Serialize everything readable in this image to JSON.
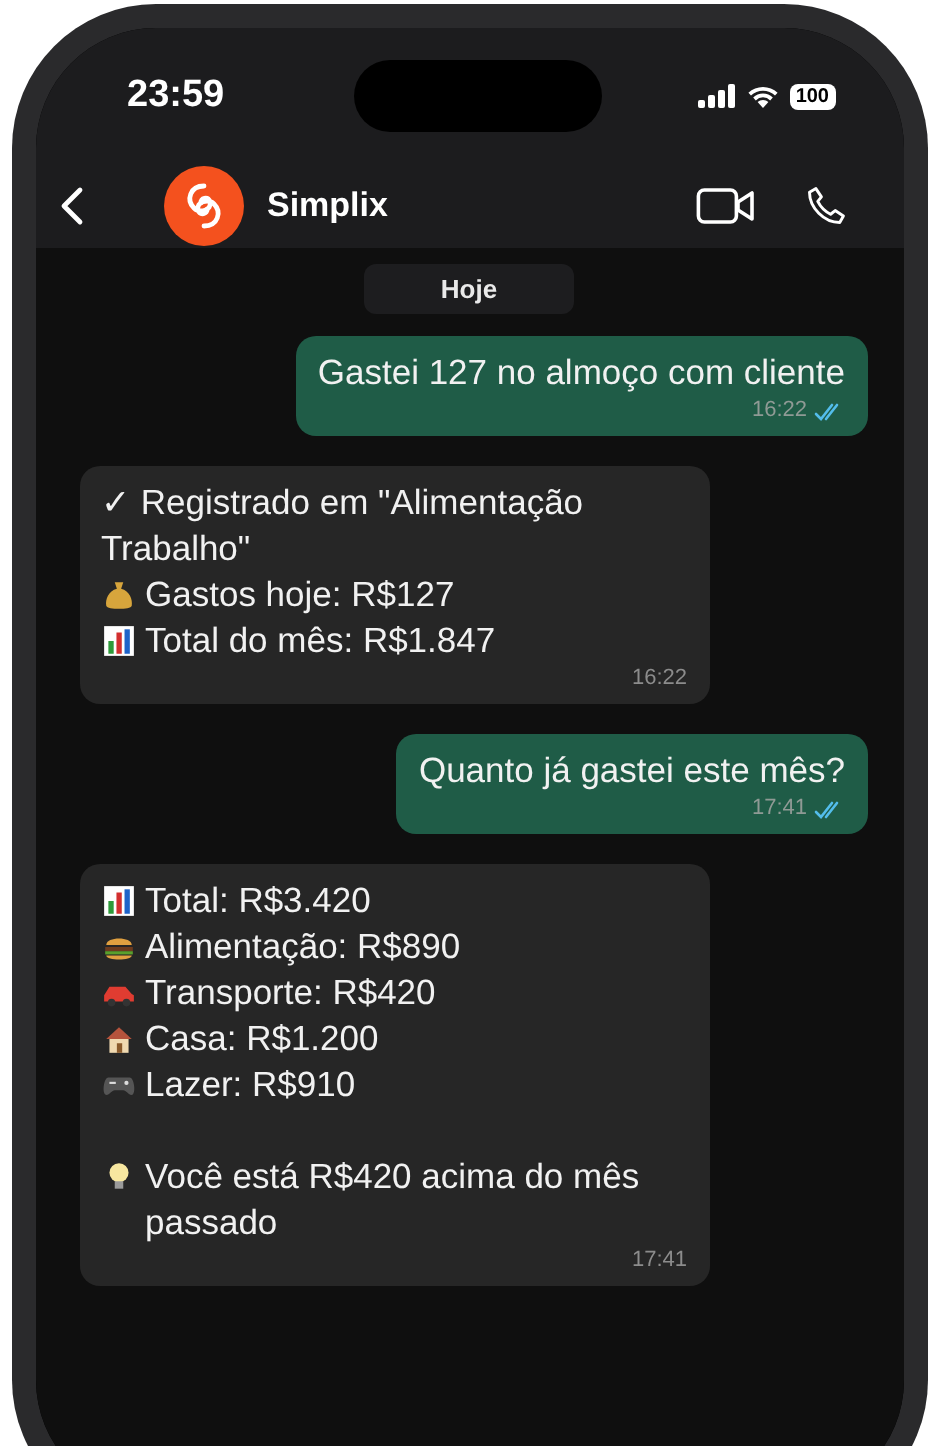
{
  "status_bar": {
    "time": "23:59",
    "battery": "100"
  },
  "header": {
    "contact": "Simplix"
  },
  "date_chip": "Hoje",
  "messages": [
    {
      "kind": "sent",
      "read": true,
      "time": "16:22",
      "lines": [
        {
          "kind": "plain",
          "text": "Gastei 127 no almoço com cliente"
        }
      ]
    },
    {
      "kind": "received",
      "time": "16:22",
      "lines": [
        {
          "kind": "plain",
          "text": "✓ Registrado em \"Alimentação Trabalho\""
        },
        {
          "kind": "moneybag",
          "text": "Gastos hoje: R$127"
        },
        {
          "kind": "chart",
          "text": "Total do mês: R$1.847"
        }
      ]
    },
    {
      "kind": "sent",
      "read": true,
      "time": "17:41",
      "lines": [
        {
          "kind": "plain",
          "text": "Quanto já gastei este mês?"
        }
      ]
    },
    {
      "kind": "received",
      "time": "17:41",
      "lines": [
        {
          "kind": "chart",
          "text": "Total: R$3.420"
        },
        {
          "kind": "burger",
          "text": "Alimentação: R$890"
        },
        {
          "kind": "car",
          "text": "Transporte: R$420"
        },
        {
          "kind": "house",
          "text": "Casa: R$1.200"
        },
        {
          "kind": "gamepad",
          "text": "Lazer: R$910"
        },
        {
          "kind": "bulb",
          "text": "Você está R$420 acima do mês passado"
        }
      ]
    }
  ]
}
